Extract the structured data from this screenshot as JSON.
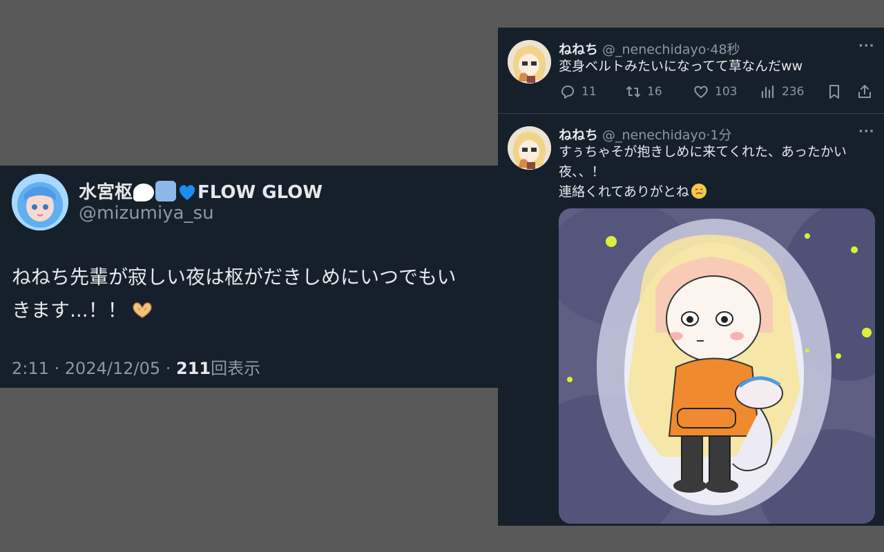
{
  "left_post": {
    "display_name": "水宮枢",
    "display_name_suffix": "FLOW GLOW",
    "handle": "@mizumiya_su",
    "body_line1": "ねねち先輩が寂しい夜は枢がだきしめにいつでもい",
    "body_line2": "きます...！！",
    "time_date": "2:11 · 2024/12/05 · ",
    "views_count": "211",
    "views_label": "回表示",
    "icons": [
      "chat-bubble-emoji",
      "repeat-emoji",
      "blue-heart-emoji",
      "heart-hands-emoji"
    ]
  },
  "tweets": [
    {
      "name": "ねねち",
      "handle": "@_nenechidayo",
      "time": "·48秒",
      "text": "変身ベルトみたいになってて草なんだww",
      "reply_count": "11",
      "retweet_count": "16",
      "like_count": "103",
      "view_count": "236"
    },
    {
      "name": "ねねち",
      "handle": "@_nenechidayo",
      "time": "·1分",
      "text_line1": "すぅちゃそが抱きしめに来てくれた、あったかい",
      "text_line2": "夜、、！",
      "text_line3": "連絡くれてありがとね"
    }
  ],
  "colors": {
    "background": "#595959",
    "card": "#15202b",
    "text": "#e7e9ea",
    "muted": "#8b98a5"
  }
}
